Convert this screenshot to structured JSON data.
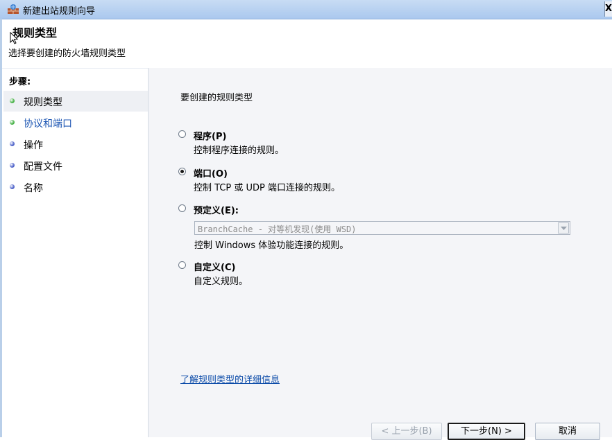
{
  "window": {
    "title": "新建出站规则向导",
    "icon": "firewall-wall-icon",
    "close_label": "X"
  },
  "header": {
    "title": "规则类型",
    "subtitle": "选择要创建的防火墙规则类型"
  },
  "steps": {
    "label": "步骤:",
    "items": [
      {
        "label": "规则类型",
        "state": "completed",
        "dot_color": "#43b043",
        "label_color": "#000000"
      },
      {
        "label": "协议和端口",
        "state": "current",
        "dot_color": "#43b043",
        "label_color": "#1d56b3"
      },
      {
        "label": "操作",
        "state": "pending",
        "dot_color": "#4a5fc8",
        "label_color": "#000000"
      },
      {
        "label": "配置文件",
        "state": "pending",
        "dot_color": "#4a5fc8",
        "label_color": "#000000"
      },
      {
        "label": "名称",
        "state": "pending",
        "dot_color": "#4a5fc8",
        "label_color": "#000000"
      }
    ]
  },
  "main": {
    "question": "要创建的规则类型",
    "options": [
      {
        "title": "程序(P)",
        "description": "控制程序连接的规则。",
        "selected": false
      },
      {
        "title": "端口(O)",
        "description": "控制 TCP 或 UDP 端口连接的规则。",
        "selected": true
      },
      {
        "title": "预定义(E):",
        "description": "",
        "selected": false
      },
      {
        "title": "自定义(C)",
        "description": "自定义规则。",
        "selected": false
      }
    ],
    "predefined_select": {
      "value": "BranchCache - 对等机发现(使用 WSD)",
      "enabled": false
    },
    "predefined_description": "控制 Windows 体验功能连接的规则。",
    "learn_more_link": "了解规则类型的详细信息"
  },
  "buttons": {
    "back": "< 上一步(B)",
    "next": "下一步(N) >",
    "cancel": "取消"
  }
}
